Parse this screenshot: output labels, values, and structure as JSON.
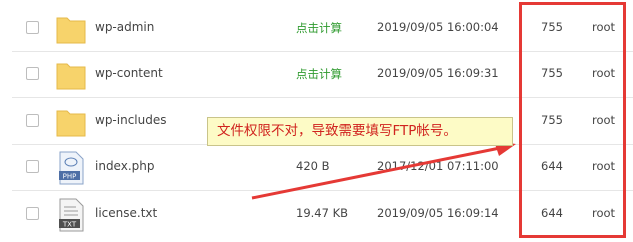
{
  "files": [
    {
      "name": "wp-admin",
      "size": "点击计算",
      "size_is_action": true,
      "mtime": "2019/09/05 16:00:04",
      "perm": "755",
      "owner": "root",
      "icon": "folder-icon"
    },
    {
      "name": "wp-content",
      "size": "点击计算",
      "size_is_action": true,
      "mtime": "2019/09/05 16:09:31",
      "perm": "755",
      "owner": "root",
      "icon": "folder-icon"
    },
    {
      "name": "wp-includes",
      "size": "",
      "size_is_action": false,
      "mtime": "",
      "perm": "755",
      "owner": "root",
      "icon": "folder-icon"
    },
    {
      "name": "index.php",
      "size": "420 B",
      "size_is_action": false,
      "mtime": "2017/12/01 07:11:00",
      "perm": "644",
      "owner": "root",
      "icon": "php-file-icon",
      "icon_label": "PHP"
    },
    {
      "name": "license.txt",
      "size": "19.47 KB",
      "size_is_action": false,
      "mtime": "2019/09/05 16:09:14",
      "perm": "644",
      "owner": "root",
      "icon": "txt-file-icon",
      "icon_label": "TXT"
    }
  ],
  "annotation": {
    "text": "文件权限不对，导致需要填写FTP帐号。"
  },
  "colors": {
    "highlight": "#e53935",
    "calc_link": "#2e9a2e",
    "folder": "#f7d36b",
    "tooltip_bg": "#fdfbc6"
  }
}
